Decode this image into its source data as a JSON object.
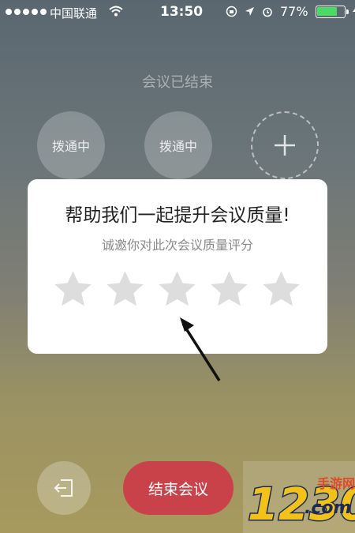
{
  "status_bar": {
    "carrier": "中国联通",
    "time": "13:50",
    "battery": "77%",
    "battery_level": 0.77,
    "icons": [
      "signal-dots",
      "wifi-icon",
      "rotation-lock-icon",
      "location-icon",
      "alarm-icon",
      "battery-icon",
      "charging-icon"
    ]
  },
  "meeting": {
    "title": "会议已结束",
    "participants": [
      {
        "status": "拨通中"
      },
      {
        "status": "拨通中"
      }
    ],
    "add_icon": "plus-icon"
  },
  "rating_dialog": {
    "title": "帮助我们一起提升会议质量!",
    "subtitle": "诚邀你对此次会议质量评分",
    "star_count": 5,
    "selected_rating": 0,
    "star_color": "#dddddd"
  },
  "controls": {
    "exit_icon": "exit-icon",
    "end_label": "结束会议",
    "end_color": "#c9424a"
  },
  "watermark": {
    "text": "1230",
    "site": "手游网",
    "domain": ".com"
  }
}
